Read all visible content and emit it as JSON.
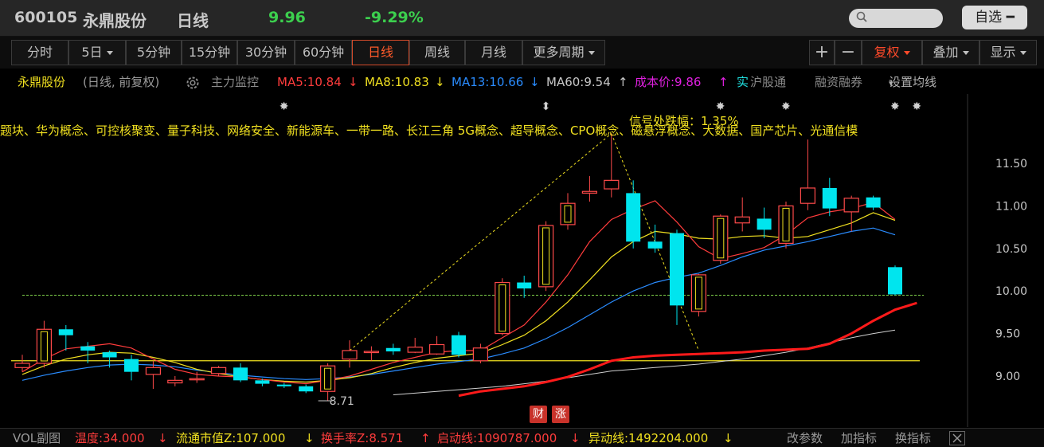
{
  "header": {
    "code": "600105",
    "name": "永鼎股份",
    "period": "日线",
    "price": "9.96",
    "change_pct": "-9.29%",
    "watchlist_button": "自选 ━"
  },
  "toolbar": {
    "tabs": [
      "分时",
      "5日",
      "5分钟",
      "15分钟",
      "30分钟",
      "60分钟",
      "日线",
      "周线",
      "月线",
      "更多周期"
    ],
    "active_tab": "日线",
    "zoom_in": "+",
    "zoom_out": "−",
    "fuquan": "复权",
    "overlay": "叠加",
    "display": "显示"
  },
  "indicator_bar": {
    "title": "永鼎股份",
    "mode": "(日线, 前复权)",
    "main_monitor": "主力监控",
    "ma5": "MA5:10.84",
    "ma8": "MA8:10.83",
    "ma13": "MA13:10.66",
    "ma60": "MA60:9.54",
    "cost": "成本价:9.86",
    "real": "实",
    "hgt": "沪股通",
    "margin": "融资融券",
    "set_ma": "设置均线"
  },
  "concepts": "题块、华为概念、可控核聚变、量子科技、网络安全、新能源车、一带一路、长江三角 5G概念、超导概念、CPO概念、磁悬浮概念、大数据、国产芯片、光通信模",
  "annotations": {
    "signal": "信号处跌幅：1.35%",
    "low_marker": "8.71"
  },
  "badges": [
    "财",
    "涨"
  ],
  "price_axis": [
    "11.50",
    "11.00",
    "10.50",
    "10.00",
    "9.50",
    "9.00"
  ],
  "colors": {
    "up": "#ff4a4a",
    "down": "#00e5ee",
    "ma5": "#ff3c3c",
    "ma8": "#f0e020",
    "ma13": "#2a8cff",
    "ma60": "#d0d0d0",
    "cost": "#e020e0"
  },
  "chart_data": {
    "type": "candlestick",
    "ylim": [
      8.6,
      12.2
    ],
    "candles": [
      {
        "o": 9.1,
        "c": 9.15,
        "h": 9.25,
        "l": 9.05
      },
      {
        "o": 9.15,
        "c": 9.55,
        "h": 9.65,
        "l": 9.1
      },
      {
        "o": 9.55,
        "c": 9.48,
        "h": 9.6,
        "l": 9.3
      },
      {
        "o": 9.35,
        "c": 9.3,
        "h": 9.4,
        "l": 9.15
      },
      {
        "o": 9.28,
        "c": 9.22,
        "h": 9.3,
        "l": 9.1
      },
      {
        "o": 9.2,
        "c": 9.05,
        "h": 9.25,
        "l": 8.95
      },
      {
        "o": 9.02,
        "c": 9.1,
        "h": 9.18,
        "l": 8.85
      },
      {
        "o": 8.92,
        "c": 8.95,
        "h": 9.0,
        "l": 8.88
      },
      {
        "o": 8.96,
        "c": 8.97,
        "h": 9.05,
        "l": 8.92
      },
      {
        "o": 9.03,
        "c": 9.1,
        "h": 9.12,
        "l": 9.0
      },
      {
        "o": 9.1,
        "c": 8.95,
        "h": 9.15,
        "l": 8.93
      },
      {
        "o": 8.95,
        "c": 8.91,
        "h": 8.97,
        "l": 8.88
      },
      {
        "o": 8.9,
        "c": 8.88,
        "h": 8.92,
        "l": 8.86
      },
      {
        "o": 8.88,
        "c": 8.82,
        "h": 8.9,
        "l": 8.8
      },
      {
        "o": 8.82,
        "c": 9.12,
        "h": 9.15,
        "l": 8.71
      },
      {
        "o": 9.2,
        "c": 9.3,
        "h": 9.42,
        "l": 9.1
      },
      {
        "o": 9.28,
        "c": 9.29,
        "h": 9.35,
        "l": 9.18
      },
      {
        "o": 9.33,
        "c": 9.29,
        "h": 9.38,
        "l": 9.25
      },
      {
        "o": 9.28,
        "c": 9.34,
        "h": 9.45,
        "l": 9.27
      },
      {
        "o": 9.26,
        "c": 9.37,
        "h": 9.47,
        "l": 9.25
      },
      {
        "o": 9.48,
        "c": 9.25,
        "h": 9.52,
        "l": 9.22
      },
      {
        "o": 9.18,
        "c": 9.33,
        "h": 9.38,
        "l": 9.15
      },
      {
        "o": 9.5,
        "c": 10.1,
        "h": 10.15,
        "l": 9.48
      },
      {
        "o": 10.1,
        "c": 10.03,
        "h": 10.18,
        "l": 9.92
      },
      {
        "o": 10.05,
        "c": 10.77,
        "h": 10.82,
        "l": 10.0
      },
      {
        "o": 10.78,
        "c": 11.03,
        "h": 11.15,
        "l": 10.72
      },
      {
        "o": 11.15,
        "c": 11.17,
        "h": 11.35,
        "l": 11.05
      },
      {
        "o": 11.2,
        "c": 11.3,
        "h": 11.85,
        "l": 11.1
      },
      {
        "o": 11.15,
        "c": 10.58,
        "h": 11.3,
        "l": 10.5
      },
      {
        "o": 10.58,
        "c": 10.5,
        "h": 10.78,
        "l": 10.45
      },
      {
        "o": 10.68,
        "c": 9.83,
        "h": 10.72,
        "l": 9.6
      },
      {
        "o": 9.76,
        "c": 10.19,
        "h": 10.2,
        "l": 9.7
      },
      {
        "o": 10.36,
        "c": 10.88,
        "h": 10.9,
        "l": 10.32
      },
      {
        "o": 10.8,
        "c": 10.87,
        "h": 11.1,
        "l": 10.7
      },
      {
        "o": 10.85,
        "c": 10.72,
        "h": 10.98,
        "l": 10.62
      },
      {
        "o": 10.56,
        "c": 11.0,
        "h": 11.05,
        "l": 10.5
      },
      {
        "o": 11.03,
        "c": 11.21,
        "h": 11.78,
        "l": 10.95
      },
      {
        "o": 11.21,
        "c": 10.97,
        "h": 11.33,
        "l": 10.88
      },
      {
        "o": 10.93,
        "c": 11.09,
        "h": 11.12,
        "l": 10.7
      },
      {
        "o": 11.1,
        "c": 10.98,
        "h": 11.12,
        "l": 10.95
      },
      {
        "o": 10.28,
        "c": 9.96,
        "h": 10.3,
        "l": 9.95
      }
    ],
    "ma5": [
      9.05,
      9.2,
      9.32,
      9.35,
      9.38,
      9.33,
      9.2,
      9.08,
      9.02,
      9.0,
      8.99,
      8.96,
      8.93,
      8.91,
      8.95,
      9.0,
      9.08,
      9.16,
      9.22,
      9.28,
      9.3,
      9.3,
      9.45,
      9.6,
      9.87,
      10.19,
      10.58,
      10.84,
      10.96,
      11.06,
      10.81,
      10.52,
      10.38,
      10.44,
      10.51,
      10.66,
      10.86,
      10.93,
      10.97,
      11.04,
      10.84
    ],
    "ma8": [
      9.02,
      9.12,
      9.2,
      9.25,
      9.28,
      9.27,
      9.22,
      9.16,
      9.08,
      9.03,
      8.99,
      8.96,
      8.94,
      8.93,
      8.95,
      8.98,
      9.03,
      9.1,
      9.16,
      9.21,
      9.24,
      9.27,
      9.37,
      9.48,
      9.65,
      9.87,
      10.13,
      10.4,
      10.58,
      10.7,
      10.67,
      10.62,
      10.61,
      10.64,
      10.65,
      10.62,
      10.64,
      10.72,
      10.8,
      10.92,
      10.83
    ],
    "ma13": [
      8.95,
      9.01,
      9.06,
      9.1,
      9.13,
      9.14,
      9.13,
      9.11,
      9.07,
      9.04,
      9.01,
      8.99,
      8.97,
      8.96,
      8.97,
      8.99,
      9.02,
      9.06,
      9.1,
      9.14,
      9.17,
      9.2,
      9.26,
      9.33,
      9.44,
      9.57,
      9.72,
      9.87,
      10.0,
      10.1,
      10.16,
      10.21,
      10.3,
      10.4,
      10.48,
      10.53,
      10.58,
      10.64,
      10.7,
      10.74,
      10.66
    ],
    "ma60": [
      null,
      null,
      null,
      null,
      null,
      null,
      null,
      null,
      null,
      null,
      null,
      null,
      null,
      null,
      null,
      null,
      null,
      8.78,
      8.8,
      8.82,
      8.84,
      8.86,
      8.88,
      8.91,
      8.94,
      8.98,
      9.02,
      9.06,
      9.08,
      9.1,
      9.12,
      9.14,
      9.17,
      9.2,
      9.24,
      9.28,
      9.33,
      9.39,
      9.45,
      9.5,
      9.54
    ],
    "cost": [
      null,
      null,
      null,
      null,
      null,
      null,
      null,
      null,
      null,
      null,
      null,
      null,
      null,
      null,
      null,
      null,
      null,
      null,
      null,
      null,
      8.77,
      8.82,
      8.85,
      8.88,
      8.93,
      8.99,
      9.08,
      9.18,
      9.22,
      9.24,
      9.25,
      9.26,
      9.27,
      9.28,
      9.3,
      9.31,
      9.32,
      9.38,
      9.5,
      9.65,
      9.78,
      9.86
    ],
    "support_line": 9.18,
    "dotted_line": 9.95
  },
  "bottom_bar": {
    "title": "VOL副图",
    "temp": "温度:34.000",
    "mcap": "流通市值Z:107.000",
    "turnover": "换手率Z:8.571",
    "start_line": "启动线:1090787.000",
    "move_line": "异动线:1492204.000",
    "edit_params": "改参数",
    "add_indicator": "加指标",
    "switch_indicator": "换指标"
  }
}
